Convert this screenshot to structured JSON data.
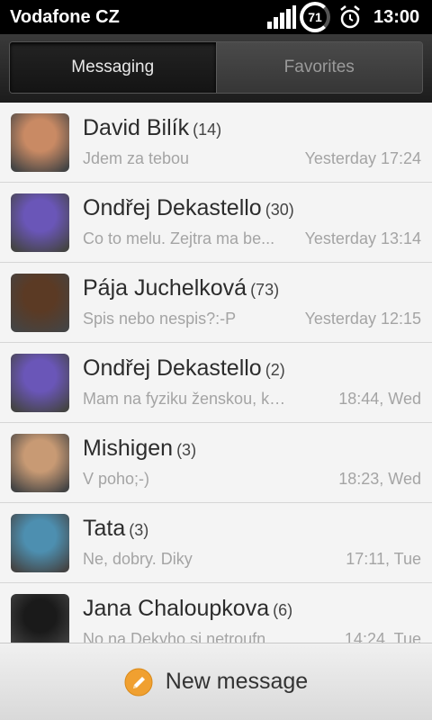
{
  "status_bar": {
    "carrier": "Vodafone CZ",
    "battery_level": "71",
    "time": "13:00",
    "icons": [
      "signal-icon",
      "battery-icon",
      "alarm-icon"
    ]
  },
  "tabs": [
    {
      "label": "Messaging",
      "active": true
    },
    {
      "label": "Favorites",
      "active": false
    }
  ],
  "conversations": [
    {
      "name": "David Bilík",
      "count": "(14)",
      "preview": "Jdem za tebou",
      "time": "Yesterday 17:24",
      "avatar_color": "#c98a64"
    },
    {
      "name": "Ondřej Dekastello",
      "count": "(30)",
      "preview": "Co to melu. Zejtra ma be...",
      "time": "Yesterday 13:14",
      "avatar_color": "#6a56b8"
    },
    {
      "name": "Pája Juchelková",
      "count": "(73)",
      "preview": "Spis nebo nespis?:-P",
      "time": "Yesterday 12:15",
      "avatar_color": "#5b3a24"
    },
    {
      "name": "Ondřej Dekastello",
      "count": "(2)",
      "preview": "Mam na fyziku ženskou, který...",
      "time": "18:44, Wed",
      "avatar_color": "#6a56b8"
    },
    {
      "name": "Mishigen",
      "count": "(3)",
      "preview": "V poho;-)",
      "time": "18:23, Wed",
      "avatar_color": "#c89a74"
    },
    {
      "name": "Tata",
      "count": "(3)",
      "preview": "Ne, dobry. Diky",
      "time": "17:11, Tue",
      "avatar_color": "#4d8fb0"
    },
    {
      "name": "Jana Chaloupkova",
      "count": "(6)",
      "preview": "No na Dekyho si netroufnes :) ...",
      "time": "14:24, Tue",
      "avatar_color": "#1a1a1a"
    }
  ],
  "bottom_bar": {
    "label": "New message",
    "icon": "pencil-icon",
    "accent": "#f0a030"
  }
}
